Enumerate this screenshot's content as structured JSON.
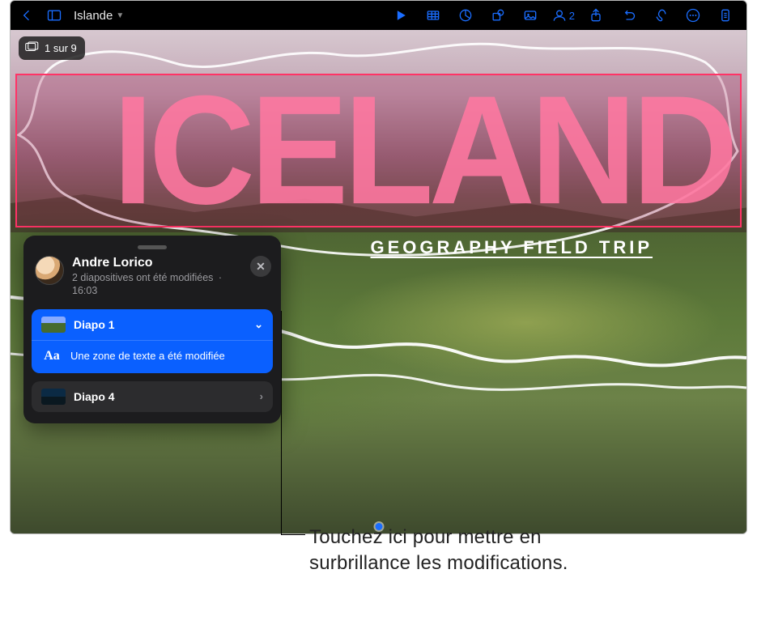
{
  "toolbar": {
    "doc_title": "Islande",
    "collab_count": "2"
  },
  "slide_badge": "1 sur 9",
  "slide": {
    "title": "ICELAND",
    "subtitle": "GEOGRAPHY FIELD TRIP"
  },
  "popover": {
    "user_name": "Andre Lorico",
    "summary": "2 diapositives ont été modifiées",
    "separator": "·",
    "time": "16:03",
    "items": [
      {
        "label": "Diapo 1",
        "detail": "Une zone de texte a été modifiée",
        "detail_icon": "Aa"
      },
      {
        "label": "Diapo 4"
      }
    ]
  },
  "callout": {
    "line1": "Touchez ici pour mettre en",
    "line2": "surbrillance les modifications."
  }
}
